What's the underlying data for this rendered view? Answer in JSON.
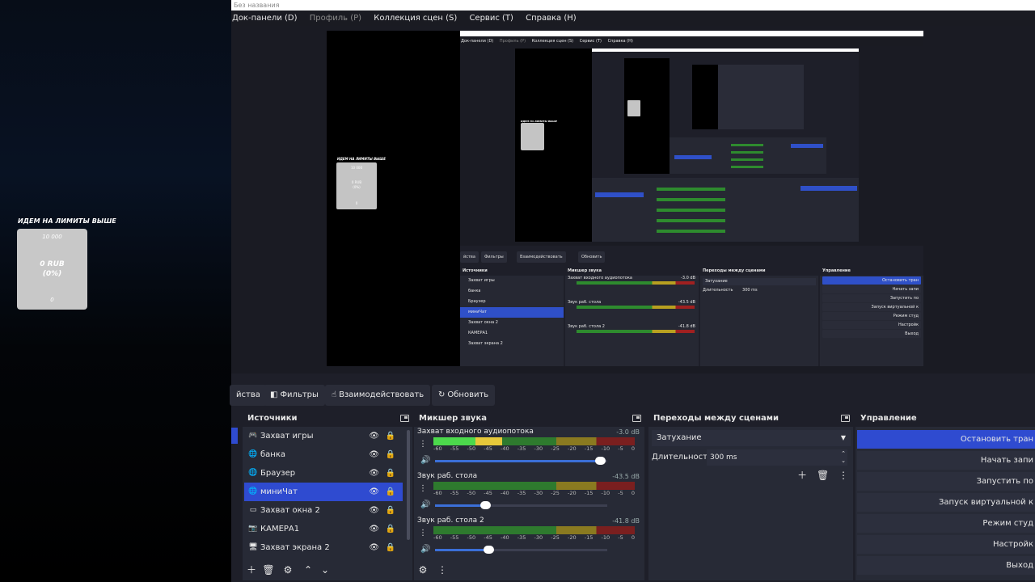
{
  "overlay": {
    "title": "ИДЕМ НА ЛИМИТЫ ВЫШЕ",
    "goal": "10 000",
    "amount": "0 RUB",
    "percent": "(0%)",
    "start": "0"
  },
  "window": {
    "title": "Без названия"
  },
  "menu": [
    {
      "label": "Док-панели (D)",
      "enabled": true
    },
    {
      "label": "Профиль (P)",
      "enabled": false
    },
    {
      "label": "Коллекция сцен (S)",
      "enabled": true
    },
    {
      "label": "Сервис (T)",
      "enabled": true
    },
    {
      "label": "Справка (H)",
      "enabled": true
    }
  ],
  "toolbar": {
    "properties_tail": "йства",
    "filters": "Фильтры",
    "interact": "Взаимодействовать",
    "refresh": "Обновить"
  },
  "sources": {
    "title": "Источники",
    "items": [
      {
        "label": "Захват игры",
        "icon": "gamepad-icon",
        "visible": true,
        "locked": false,
        "selected": false
      },
      {
        "label": "банка",
        "icon": "globe-icon",
        "visible": true,
        "locked": true,
        "selected": false
      },
      {
        "label": "Браузер",
        "icon": "globe-icon",
        "visible": true,
        "locked": true,
        "selected": false
      },
      {
        "label": "миниЧат",
        "icon": "globe-icon",
        "visible": true,
        "locked": true,
        "selected": true
      },
      {
        "label": "Захват окна 2",
        "icon": "window-icon",
        "visible": true,
        "locked": false,
        "selected": false
      },
      {
        "label": "КАМЕРА1",
        "icon": "camera-icon",
        "visible": true,
        "locked": true,
        "selected": false
      },
      {
        "label": "Захват экрана 2",
        "icon": "monitor-icon",
        "visible": true,
        "locked": true,
        "selected": false
      }
    ]
  },
  "mixer": {
    "title": "Микшер звука",
    "ticks": [
      "-60",
      "-55",
      "-50",
      "-45",
      "-40",
      "-35",
      "-30",
      "-25",
      "-20",
      "-15",
      "-10",
      "-5",
      "0"
    ],
    "channels": [
      {
        "name": "Захват входного аудиопотока",
        "db": "-3.0 dB",
        "level": 0.34,
        "volume": 0.96
      },
      {
        "name": "Звук раб. стола",
        "db": "-43.5 dB",
        "level": 0.0,
        "volume": 0.29
      },
      {
        "name": "Звук раб. стола 2",
        "db": "-41.8 dB",
        "level": 0.0,
        "volume": 0.31
      }
    ]
  },
  "transitions": {
    "title": "Переходы между сценами",
    "selected": "Затухание",
    "duration_label": "Длительность",
    "duration_value": "300 ms"
  },
  "controls": {
    "title": "Управление",
    "buttons": [
      {
        "label": "Остановить тран",
        "primary": true
      },
      {
        "label": "Начать запи",
        "primary": false
      },
      {
        "label": "Запустить по",
        "primary": false
      },
      {
        "label": "Запуск виртуальной к",
        "primary": false
      },
      {
        "label": "Режим студ",
        "primary": false
      },
      {
        "label": "Настройк",
        "primary": false
      },
      {
        "label": "Выход",
        "primary": false
      }
    ]
  },
  "nested": {
    "menu": [
      "Док-панели (D)",
      "Профиль (P)",
      "Коллекция сцен (S)",
      "Сервис (T)",
      "Справка (H)"
    ],
    "toolbar": [
      "йства",
      "Фильтры",
      "Взаимодействовать",
      "Обновить"
    ],
    "sources_title": "Источники",
    "sources": [
      "Захват игры",
      "банка",
      "Браузер",
      "миниЧат",
      "Захват окна 2",
      "КАМЕРА1",
      "Захват экрана 2"
    ],
    "mixer_title": "Микшер звука",
    "mixer_channels": [
      "Захват входного аудиопотока",
      "Звук раб. стола",
      "Звук раб. стола 2"
    ],
    "mixer_db": [
      "-3.0 dB",
      "-43.5 dB",
      "-41.8 dB"
    ],
    "transitions_title": "Переходы между сценами",
    "transition": "Затухание",
    "duration_label": "Длительность",
    "duration_value": "300 ms",
    "controls_title": "Управление",
    "controls": [
      "Остановить тран",
      "Начать запи",
      "Запустить по",
      "Запуск виртуальной к",
      "Режим студ",
      "Настройк",
      "Выход"
    ]
  }
}
